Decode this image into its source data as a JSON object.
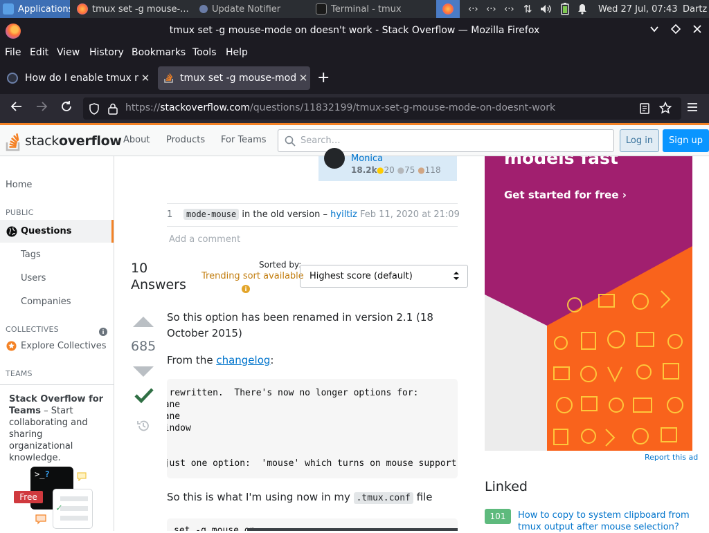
{
  "taskbar": {
    "apps_label": "Applications",
    "tasks": [
      "tmux set -g mouse-...",
      "Update Notifier",
      "Terminal - tmux"
    ],
    "clock": "Wed 27 Jul, 07:43",
    "user": "Dartz"
  },
  "window": {
    "title": "tmux set -g mouse-mode on doesn't work - Stack Overflow — Mozilla Firefox"
  },
  "menu": [
    "File",
    "Edit",
    "View",
    "History",
    "Bookmarks",
    "Tools",
    "Help"
  ],
  "tabs": [
    {
      "label": "How do I enable tmux mouse"
    },
    {
      "label": "tmux set -g mouse-mode on"
    }
  ],
  "url": {
    "prefix": "https://",
    "host": "stackoverflow.com",
    "path": "/questions/11832199/tmux-set-g-mouse-mode-on-doesnt-work"
  },
  "so_header": {
    "logo_light": "stack",
    "logo_bold": "overflow",
    "nav": [
      "About",
      "Products",
      "For Teams"
    ],
    "search_placeholder": "Search…",
    "login": "Log in",
    "signup": "Sign up"
  },
  "sidebar": {
    "home": "Home",
    "public_heading": "PUBLIC",
    "questions": "Questions",
    "tags": "Tags",
    "users": "Users",
    "companies": "Companies",
    "collectives_heading": "COLLECTIVES",
    "explore_collectives": "Explore Collectives",
    "teams_heading": "TEAMS",
    "teams_title": "Stack Overflow for Teams",
    "teams_text": " – Start collaborating and sharing organizational knowledge.",
    "free_badge": "Free"
  },
  "usercard": {
    "name": "Monica",
    "reputation": "18.2k",
    "gold": "20",
    "silver": "75",
    "bronze": "118"
  },
  "comment": {
    "score": "1",
    "code": "mode-mouse",
    "text": " in the old version – ",
    "author": "hyiltiz",
    "date": "Feb 11, 2020 at 21:09",
    "add_comment": "Add a comment"
  },
  "answers": {
    "count": "10",
    "label": "Answers",
    "sorted_by": "Sorted by:",
    "trending": "Trending sort available",
    "sort_value": "Highest score (default)"
  },
  "answer": {
    "score": "685",
    "para1": "So this option has been renamed in version 2.1 (18 October 2015)",
    "from_the": "From the ",
    "changelog": "changelog",
    "colon": ":",
    "code_lines": [
      "en rewritten.  There's now no longer options for:",
      "-pane",
      "-pane",
      "-window",
      "",
      "",
      "  just one option:  'mouse' which turns on mouse support"
    ],
    "para3_before": "So this is what I'm using now in my ",
    "para3_code": ".tmux.conf",
    "para3_after": " file",
    "code2": "set -g mouse on"
  },
  "ad": {
    "headline": "models fast",
    "cta": "Get started for free ›",
    "report": "Report this ad"
  },
  "linked": {
    "title": "Linked",
    "badge": "101",
    "link": "How to copy to system clipboard from tmux output after mouse selection?"
  },
  "colors": {
    "so_orange": "#f48225",
    "so_blue": "#0a95ff",
    "accepted_green": "#2f6f44",
    "ad_magenta": "#a11f6f",
    "ad_orange": "#f9631c"
  }
}
